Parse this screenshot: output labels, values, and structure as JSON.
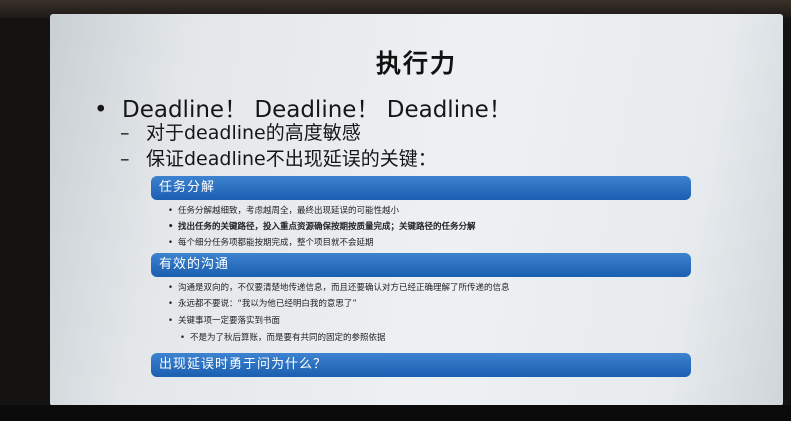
{
  "slide": {
    "title": "执行力",
    "bullet_marker": "•",
    "main_bullet": "Deadline！ Deadline！ Deadline！",
    "dash_marker": "–",
    "dash_items": [
      "对于deadline的高度敏感",
      "保证deadline不出现延误的关键："
    ],
    "sections": [
      {
        "label": "任务分解",
        "items": [
          "任务分解越细致，考虑越周全，最终出现延误的可能性越小",
          "找出任务的关键路径，投入重点资源确保按期按质量完成；关键路径的任务分解",
          "每个细分任务项都能按期完成，整个项目就不会延期"
        ]
      },
      {
        "label": "有效的沟通",
        "items": [
          "沟通是双向的，不仅要清楚地传递信息，而且还要确认对方已经正确理解了所传递的信息",
          "永远都不要说：“我以为他已经明白我的意思了”",
          "关键事项一定要落实到书面",
          "不是为了秋后算账，而是要有共同的固定的参照依据"
        ]
      },
      {
        "label": "出现延误时勇于问为什么？",
        "items": []
      }
    ],
    "sub_marker": "•",
    "colors": {
      "bar_blue": "#1f66b8",
      "screen_bg": "#eceff1"
    }
  }
}
